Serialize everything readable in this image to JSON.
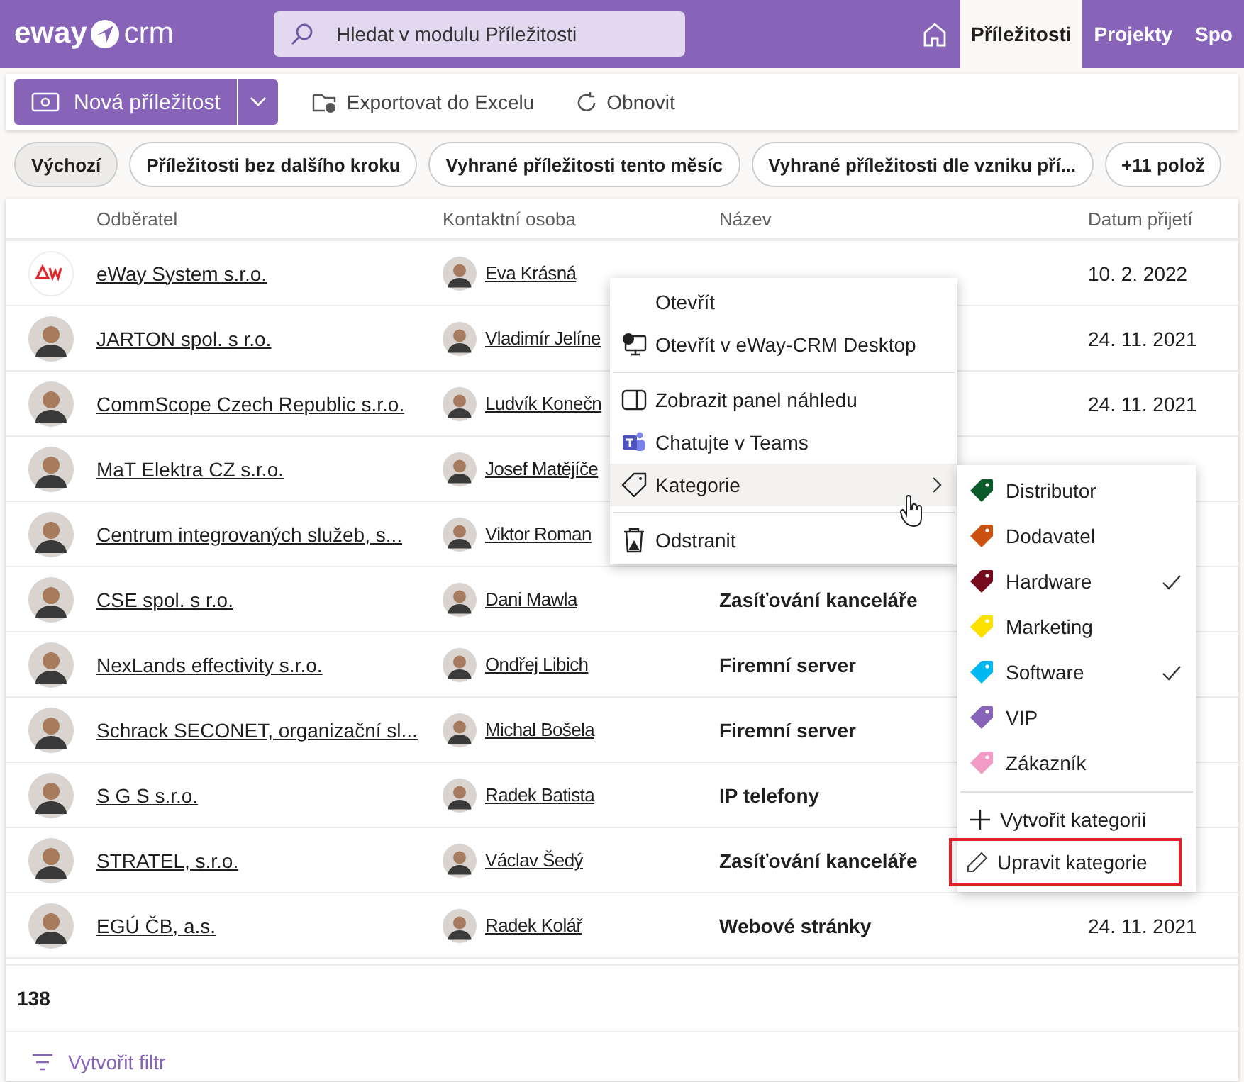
{
  "header": {
    "logo_left": "eway",
    "logo_right": "crm",
    "search": {
      "placeholder": "Hledat v modulu Příležitosti"
    },
    "tabs": [
      {
        "label": "Příležitosti",
        "selected": true
      },
      {
        "label": "Projekty",
        "selected": false
      },
      {
        "label": "Spo",
        "selected": false
      }
    ]
  },
  "toolbar": {
    "new_button": "Nová příležitost",
    "actions": [
      "Exportovat do Excelu",
      "Obnovit"
    ]
  },
  "filters": [
    {
      "label": "Výchozí",
      "selected": true
    },
    {
      "label": "Příležitosti bez dalšího kroku",
      "selected": false
    },
    {
      "label": "Vyhrané příležitosti tento měsíc",
      "selected": false
    },
    {
      "label": "Vyhrané příležitosti dle vzniku pří...",
      "selected": false
    },
    {
      "label": "+11 polož",
      "selected": false
    }
  ],
  "table": {
    "columns": [
      "Odběratel",
      "Kontaktní osoba",
      "Název",
      "Datum přijetí"
    ],
    "rows": [
      {
        "kind": "logo",
        "customer": "eWay System s.r.o.",
        "contact": "Eva Krásná",
        "date": "10. 2. 2022"
      },
      {
        "kind": "person",
        "customer": "JARTON spol. s r.o.",
        "contact": "Vladimír Jelíne",
        "date": "24. 11. 2021"
      },
      {
        "kind": "person",
        "customer": "CommScope Czech Republic s.r.o.",
        "contact": "Ludvík Konečn",
        "date": "24. 11. 2021"
      },
      {
        "kind": "person",
        "customer": "MaT Elektra CZ s.r.o.",
        "contact": "Josef Matějíče"
      },
      {
        "kind": "person",
        "customer": "Centrum integrovaných služeb, s...",
        "contact": "Viktor Roman"
      },
      {
        "kind": "person",
        "customer": "CSE spol. s r.o.",
        "contact": "Dani Mawla",
        "name": "Zasíťování kanceláře"
      },
      {
        "kind": "person",
        "customer": "NexLands effectivity s.r.o.",
        "contact": "Ondřej Libich",
        "name": "Firemní server"
      },
      {
        "kind": "person",
        "customer": "Schrack SECONET, organizační sl...",
        "contact": "Michal Bošela",
        "name": "Firemní server"
      },
      {
        "kind": "person",
        "customer": "S G S s.r.o.",
        "contact": "Radek Batista",
        "name": "IP telefony"
      },
      {
        "kind": "person",
        "customer": "STRATEL, s.r.o.",
        "contact": "Václav Šedý",
        "name": "Zasíťování kanceláře"
      },
      {
        "kind": "person",
        "customer": "EGÚ ČB, a.s.",
        "contact": "Radek Kolář",
        "name": "Webové stránky",
        "date": "24. 11. 2021"
      }
    ],
    "count": "138",
    "create_filter": "Vytvořit filtr"
  },
  "context_menu": {
    "items": [
      {
        "kind": "item",
        "label": "Otevřít",
        "highlighted": false
      },
      {
        "kind": "item",
        "label": "Otevřít v eWay-CRM Desktop",
        "highlighted": false
      },
      {
        "kind": "separator"
      },
      {
        "kind": "item",
        "label": "Zobrazit panel náhledu",
        "highlighted": false
      },
      {
        "kind": "item",
        "label": "Chatujte v Teams",
        "highlighted": false
      },
      {
        "kind": "submenu",
        "label": "Kategorie",
        "highlighted": true
      },
      {
        "kind": "separator"
      },
      {
        "kind": "item",
        "label": "Odstranit",
        "highlighted": false
      }
    ]
  },
  "category_menu": {
    "categories": [
      {
        "label": "Distributor",
        "color": "#0b5a2a",
        "checked": false
      },
      {
        "label": "Dodavatel",
        "color": "#ca5010",
        "checked": false
      },
      {
        "label": "Hardware",
        "color": "#750b1c",
        "checked": true
      },
      {
        "label": "Marketing",
        "color": "#fce100",
        "checked": false
      },
      {
        "label": "Software",
        "color": "#00b7f0",
        "checked": true
      },
      {
        "label": "VIP",
        "color": "#8764b8",
        "checked": false
      },
      {
        "label": "Zákazník",
        "color": "#f29bc6",
        "checked": false
      }
    ],
    "actions": [
      {
        "label": "Vytvořit kategorii",
        "outlined": false
      },
      {
        "label": "Upravit kategorie",
        "outlined": true
      }
    ]
  }
}
